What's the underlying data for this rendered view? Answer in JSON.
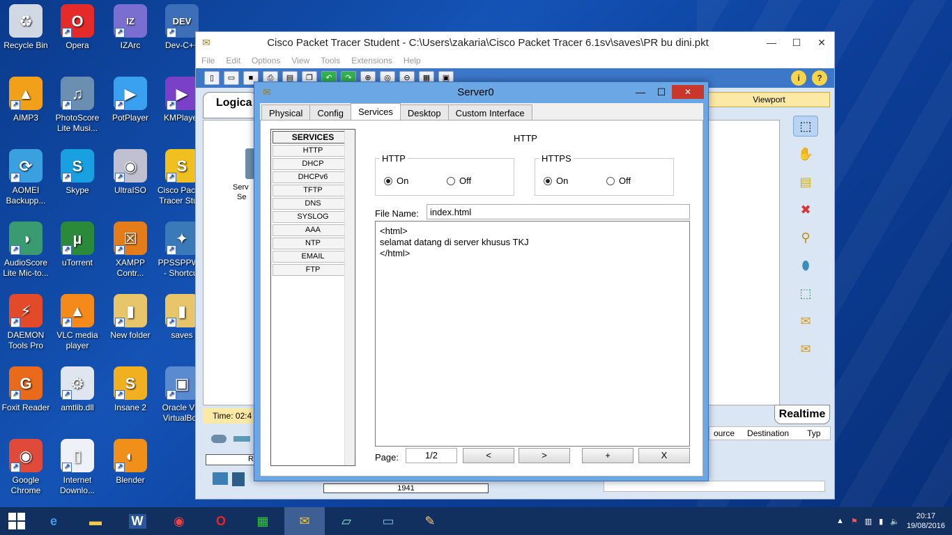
{
  "desktop": {
    "icons": [
      {
        "label": "Recycle Bin",
        "icon": "recycle-bin-icon"
      },
      {
        "label": "Opera",
        "icon": "opera-icon"
      },
      {
        "label": "IZArc",
        "icon": "izarc-icon"
      },
      {
        "label": "Dev-C++",
        "icon": "devcpp-icon"
      },
      {
        "label": "AIMP3",
        "icon": "aimp-icon"
      },
      {
        "label": "PhotoScore Lite Musi...",
        "icon": "photoscore-icon"
      },
      {
        "label": "PotPlayer",
        "icon": "potplayer-icon"
      },
      {
        "label": "KMPlayer",
        "icon": "kmplayer-icon"
      },
      {
        "label": "AOMEI Backupp...",
        "icon": "aomei-icon"
      },
      {
        "label": "Skype",
        "icon": "skype-icon"
      },
      {
        "label": "UltraISO",
        "icon": "ultraiso-icon"
      },
      {
        "label": "Cisco Packet Tracer Stu...",
        "icon": "packet-tracer-icon"
      },
      {
        "label": "AudioScore Lite Mic-to...",
        "icon": "audioscore-icon"
      },
      {
        "label": "uTorrent",
        "icon": "utorrent-icon"
      },
      {
        "label": "XAMPP Contr...",
        "icon": "xampp-icon"
      },
      {
        "label": "PPSSPPW... - Shortcut",
        "icon": "ppsspp-icon"
      },
      {
        "label": "DAEMON Tools Pro",
        "icon": "daemon-tools-icon"
      },
      {
        "label": "VLC media player",
        "icon": "vlc-icon"
      },
      {
        "label": "New folder",
        "icon": "folder-icon"
      },
      {
        "label": "saves",
        "icon": "folder-icon"
      },
      {
        "label": "Foxit Reader",
        "icon": "foxit-icon"
      },
      {
        "label": "amtlib.dll",
        "icon": "dll-file-icon"
      },
      {
        "label": "Insane 2",
        "icon": "insane-icon"
      },
      {
        "label": "Oracle VM VirtualBox",
        "icon": "virtualbox-icon"
      },
      {
        "label": "Google Chrome",
        "icon": "chrome-icon"
      },
      {
        "label": "Internet Downlo...",
        "icon": "idm-icon"
      },
      {
        "label": "Blender",
        "icon": "blender-icon"
      }
    ]
  },
  "pt": {
    "title": "Cisco Packet Tracer Student - C:\\Users\\zakaria\\Cisco Packet Tracer 6.1sv\\saves\\PR bu dini.pkt",
    "menu": [
      "File",
      "Edit",
      "Options",
      "View",
      "Tools",
      "Extensions",
      "Help"
    ],
    "logical_tab": "Logica",
    "viewport": "Viewport",
    "time": "Time: 02:4",
    "realtime": "Realtime",
    "pdu_columns": [
      "ource",
      "Destination",
      "Typ"
    ],
    "device_label_1": "Serv",
    "device_label_2": "Se",
    "device_box": "Ro",
    "model": "1941"
  },
  "server": {
    "title": "Server0",
    "tabs": [
      "Physical",
      "Config",
      "Services",
      "Desktop",
      "Custom Interface"
    ],
    "active_tab": "Services",
    "services_header": "SERVICES",
    "services": [
      "HTTP",
      "DHCP",
      "DHCPv6",
      "TFTP",
      "DNS",
      "SYSLOG",
      "AAA",
      "NTP",
      "EMAIL",
      "FTP"
    ],
    "panel_title": "HTTP",
    "http_group": "HTTP",
    "https_group": "HTTPS",
    "on_label": "On",
    "off_label": "Off",
    "http_on": true,
    "https_on": true,
    "file_name_label": "File Name:",
    "file_name": "index.html",
    "editor_content": "<html>\nselamat datang di server khusus TKJ\n</html>",
    "page_label": "Page:",
    "page_value": "1/2",
    "buttons": {
      "prev": "<",
      "next": ">",
      "add": "+",
      "remove": "X"
    }
  },
  "taskbar": {
    "time": "20:17",
    "date": "19/08/2016"
  }
}
